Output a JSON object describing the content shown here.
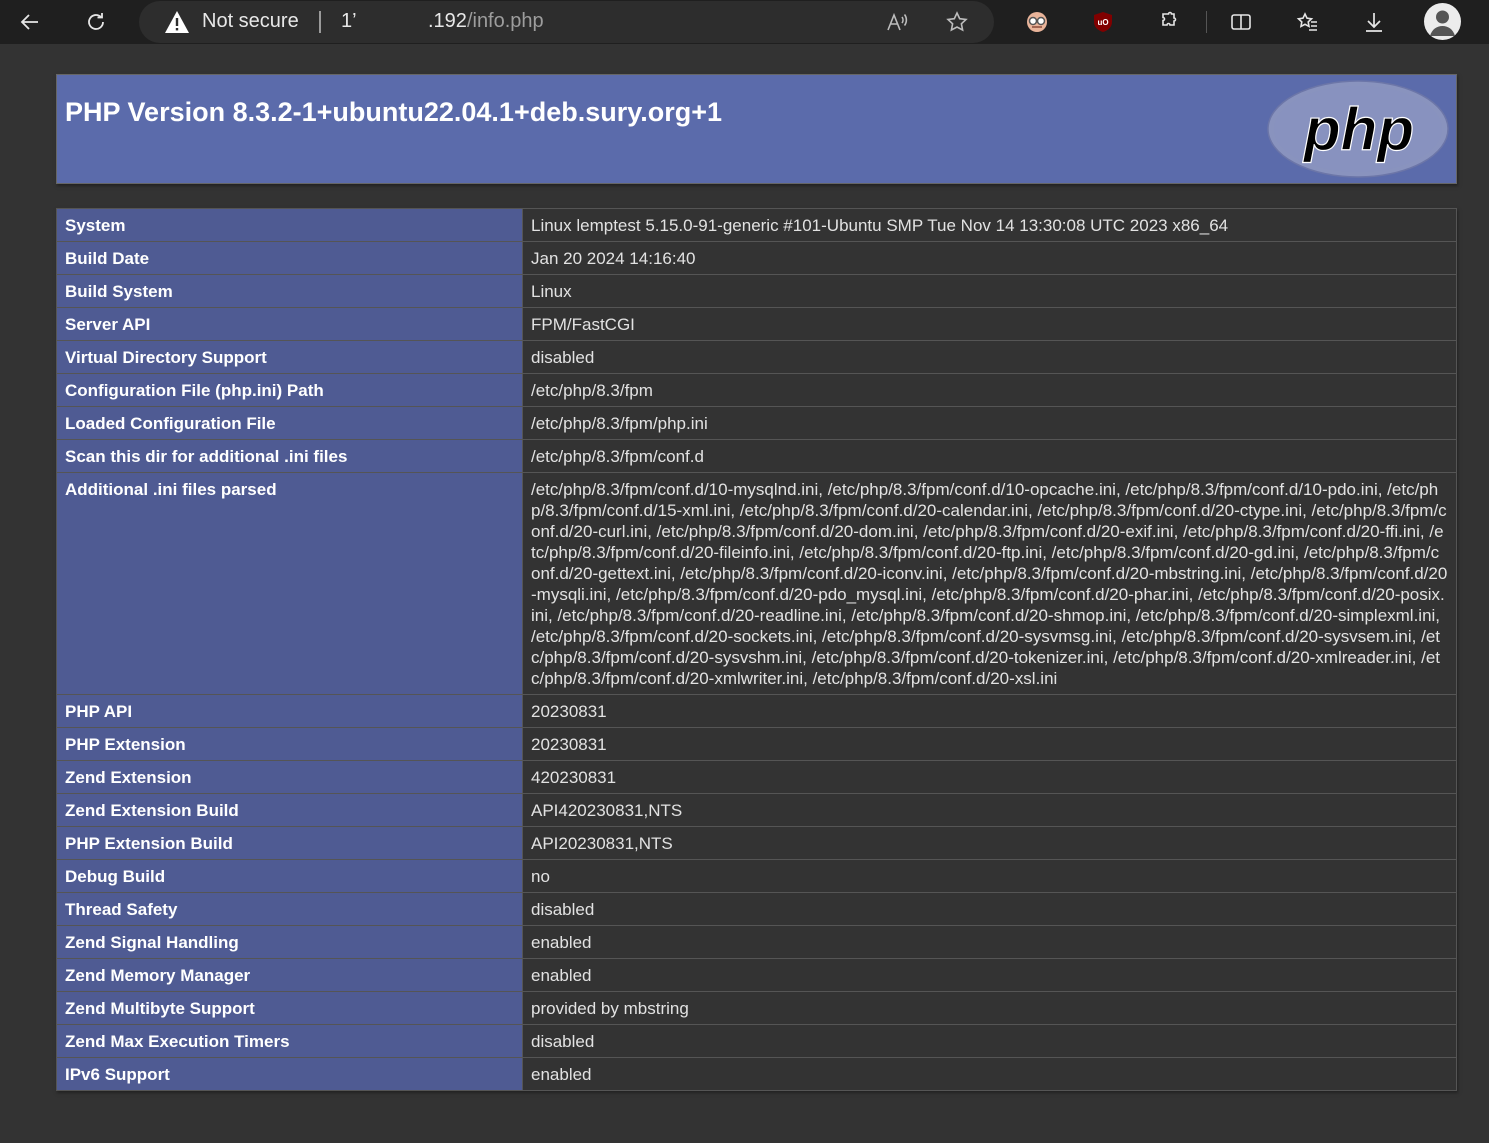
{
  "browser": {
    "security_label": "Not secure",
    "url_host_a": "1’",
    "url_host_b": ".192",
    "url_path": "/info.php",
    "icons": [
      "back-icon",
      "refresh-icon",
      "warning-icon",
      "read-aloud-icon",
      "favorite-star-icon",
      "extension-glasses-icon",
      "ublock-icon",
      "extensions-puzzle-icon",
      "split-screen-icon",
      "favorites-list-icon",
      "download-icon",
      "profile-avatar-icon"
    ]
  },
  "page": {
    "title": "PHP Version 8.3.2-1+ubuntu22.04.1+deb.sury.org+1",
    "logo_text": "php",
    "colors": {
      "header_bg": "#5b6bab",
      "label_bg": "#4f5b93",
      "value_bg": "#333333",
      "page_bg": "#333333"
    }
  },
  "rows": [
    {
      "label": "System",
      "value": "Linux lemptest 5.15.0-91-generic #101-Ubuntu SMP Tue Nov 14 13:30:08 UTC 2023 x86_64"
    },
    {
      "label": "Build Date",
      "value": "Jan 20 2024 14:16:40"
    },
    {
      "label": "Build System",
      "value": "Linux"
    },
    {
      "label": "Server API",
      "value": "FPM/FastCGI"
    },
    {
      "label": "Virtual Directory Support",
      "value": "disabled"
    },
    {
      "label": "Configuration File (php.ini) Path",
      "value": "/etc/php/8.3/fpm"
    },
    {
      "label": "Loaded Configuration File",
      "value": "/etc/php/8.3/fpm/php.ini"
    },
    {
      "label": "Scan this dir for additional .ini files",
      "value": "/etc/php/8.3/fpm/conf.d"
    },
    {
      "label": "Additional .ini files parsed",
      "value": "/etc/php/8.3/fpm/conf.d/10-mysqlnd.ini, /etc/php/8.3/fpm/conf.d/10-opcache.ini, /etc/php/8.3/fpm/conf.d/10-pdo.ini, /etc/php/8.3/fpm/conf.d/15-xml.ini, /etc/php/8.3/fpm/conf.d/20-calendar.ini, /etc/php/8.3/fpm/conf.d/20-ctype.ini, /etc/php/8.3/fpm/conf.d/20-curl.ini, /etc/php/8.3/fpm/conf.d/20-dom.ini, /etc/php/8.3/fpm/conf.d/20-exif.ini, /etc/php/8.3/fpm/conf.d/20-ffi.ini, /etc/php/8.3/fpm/conf.d/20-fileinfo.ini, /etc/php/8.3/fpm/conf.d/20-ftp.ini, /etc/php/8.3/fpm/conf.d/20-gd.ini, /etc/php/8.3/fpm/conf.d/20-gettext.ini, /etc/php/8.3/fpm/conf.d/20-iconv.ini, /etc/php/8.3/fpm/conf.d/20-mbstring.ini, /etc/php/8.3/fpm/conf.d/20-mysqli.ini, /etc/php/8.3/fpm/conf.d/20-pdo_mysql.ini, /etc/php/8.3/fpm/conf.d/20-phar.ini, /etc/php/8.3/fpm/conf.d/20-posix.ini, /etc/php/8.3/fpm/conf.d/20-readline.ini, /etc/php/8.3/fpm/conf.d/20-shmop.ini, /etc/php/8.3/fpm/conf.d/20-simplexml.ini, /etc/php/8.3/fpm/conf.d/20-sockets.ini, /etc/php/8.3/fpm/conf.d/20-sysvmsg.ini, /etc/php/8.3/fpm/conf.d/20-sysvsem.ini, /etc/php/8.3/fpm/conf.d/20-sysvshm.ini, /etc/php/8.3/fpm/conf.d/20-tokenizer.ini, /etc/php/8.3/fpm/conf.d/20-xmlreader.ini, /etc/php/8.3/fpm/conf.d/20-xmlwriter.ini, /etc/php/8.3/fpm/conf.d/20-xsl.ini"
    },
    {
      "label": "PHP API",
      "value": "20230831"
    },
    {
      "label": "PHP Extension",
      "value": "20230831"
    },
    {
      "label": "Zend Extension",
      "value": "420230831"
    },
    {
      "label": "Zend Extension Build",
      "value": "API420230831,NTS"
    },
    {
      "label": "PHP Extension Build",
      "value": "API20230831,NTS"
    },
    {
      "label": "Debug Build",
      "value": "no"
    },
    {
      "label": "Thread Safety",
      "value": "disabled"
    },
    {
      "label": "Zend Signal Handling",
      "value": "enabled"
    },
    {
      "label": "Zend Memory Manager",
      "value": "enabled"
    },
    {
      "label": "Zend Multibyte Support",
      "value": "provided by mbstring"
    },
    {
      "label": "Zend Max Execution Timers",
      "value": "disabled"
    },
    {
      "label": "IPv6 Support",
      "value": "enabled"
    }
  ]
}
